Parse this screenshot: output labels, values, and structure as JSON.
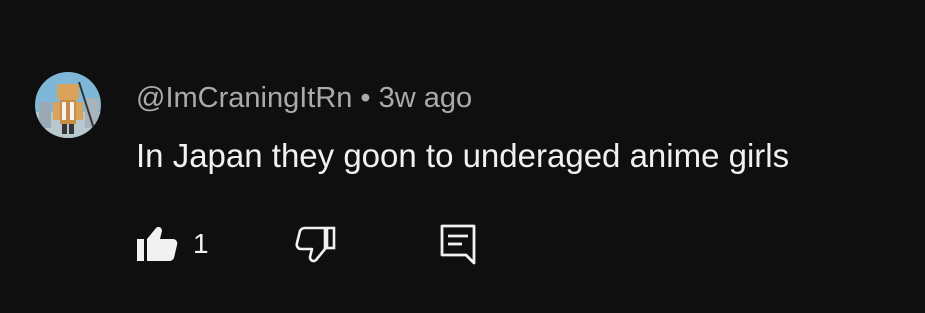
{
  "comment": {
    "author": "@ImCraningItRn",
    "separator": "•",
    "time": "3w ago",
    "text": "In Japan they goon to underaged anime girls",
    "avatar": "avatar-image",
    "actions": {
      "like_icon": "thumbs-up-filled-icon",
      "like_count": "1",
      "dislike_icon": "thumbs-down-outline-icon",
      "reply_icon": "reply-comment-icon"
    },
    "colors": {
      "background": "#0f0f0f",
      "text": "#f1f1f1",
      "meta": "#aaaaaa"
    }
  }
}
